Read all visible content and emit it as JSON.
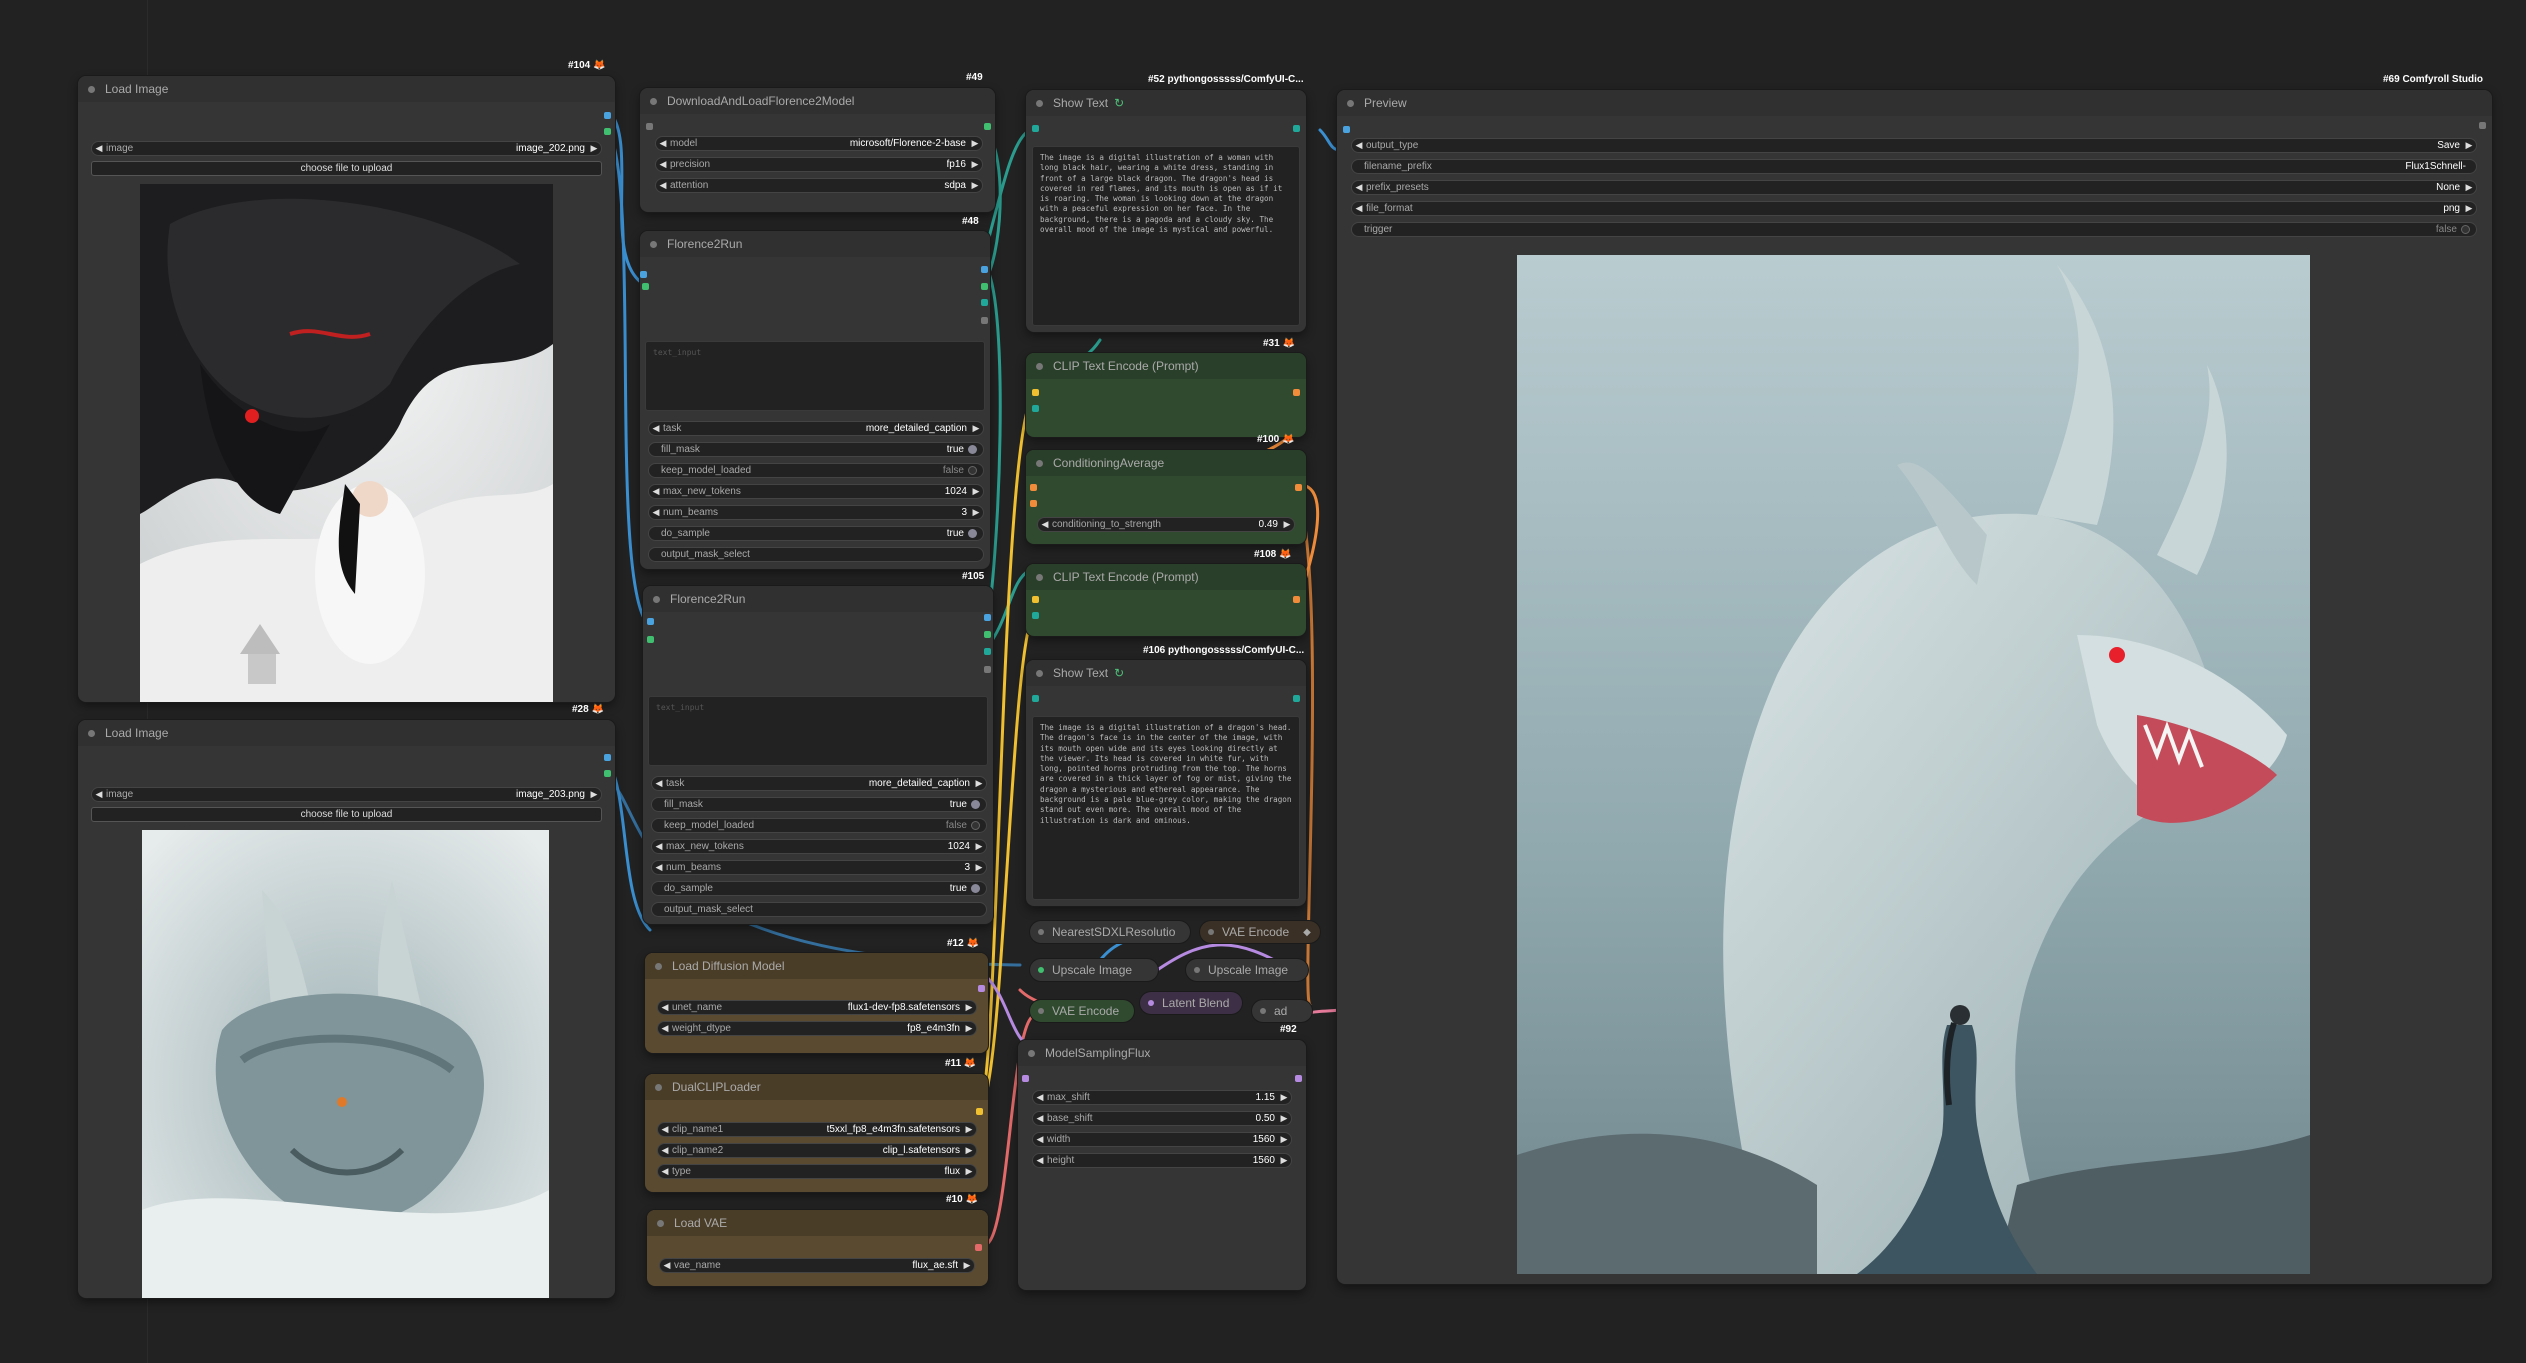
{
  "colors": {
    "canvas": "#222222",
    "node": "#353535",
    "green_node": "#2f4a2f",
    "brown_node": "#5a4a30"
  },
  "nodes": {
    "load_image_1": {
      "title": "Load Image",
      "badge": "#104",
      "image_label": "image",
      "image_value": "image_202.png",
      "upload_label": "choose file to upload"
    },
    "load_image_2": {
      "title": "Load Image",
      "badge": "#28",
      "image_label": "image",
      "image_value": "image_203.png",
      "upload_label": "choose file to upload"
    },
    "download_florence": {
      "title": "DownloadAndLoadFlorence2Model",
      "badge": "#49",
      "widgets": [
        {
          "label": "model",
          "value": "microsoft/Florence-2-base"
        },
        {
          "label": "precision",
          "value": "fp16"
        },
        {
          "label": "attention",
          "value": "sdpa"
        }
      ]
    },
    "florence_run_1": {
      "title": "Florence2Run",
      "badge": "#48",
      "placeholder": "text_input",
      "widgets": [
        {
          "label": "task",
          "value": "more_detailed_caption"
        },
        {
          "label": "fill_mask",
          "value": "true"
        },
        {
          "label": "keep_model_loaded",
          "value": "false"
        },
        {
          "label": "max_new_tokens",
          "value": "1024"
        },
        {
          "label": "num_beams",
          "value": "3"
        },
        {
          "label": "do_sample",
          "value": "true"
        },
        {
          "label": "output_mask_select",
          "value": ""
        }
      ]
    },
    "florence_run_2": {
      "title": "Florence2Run",
      "badge": "#105",
      "placeholder": "text_input",
      "widgets": [
        {
          "label": "task",
          "value": "more_detailed_caption"
        },
        {
          "label": "fill_mask",
          "value": "true"
        },
        {
          "label": "keep_model_loaded",
          "value": "false"
        },
        {
          "label": "max_new_tokens",
          "value": "1024"
        },
        {
          "label": "num_beams",
          "value": "3"
        },
        {
          "label": "do_sample",
          "value": "true"
        },
        {
          "label": "output_mask_select",
          "value": ""
        }
      ]
    },
    "load_diffusion": {
      "title": "Load Diffusion Model",
      "badge": "#12",
      "widgets": [
        {
          "label": "unet_name",
          "value": "flux1-dev-fp8.safetensors"
        },
        {
          "label": "weight_dtype",
          "value": "fp8_e4m3fn"
        }
      ]
    },
    "dual_clip": {
      "title": "DualCLIPLoader",
      "badge": "#11",
      "widgets": [
        {
          "label": "clip_name1",
          "value": "t5xxl_fp8_e4m3fn.safetensors"
        },
        {
          "label": "clip_name2",
          "value": "clip_l.safetensors"
        },
        {
          "label": "type",
          "value": "flux"
        }
      ]
    },
    "load_vae": {
      "title": "Load VAE",
      "badge": "#10",
      "widgets": [
        {
          "label": "vae_name",
          "value": "flux_ae.sft"
        }
      ]
    },
    "show_text_1": {
      "title": "Show Text",
      "badge": "#52 pythongosssss/ComfyUI-C...",
      "text": "The image is a digital illustration of a woman with long black hair, wearing a white dress, standing in front of a large black dragon. The dragon's head is covered in red flames, and its mouth is open as if it is roaring. The woman is looking down at the dragon with a peaceful expression on her face. In the background, there is a pagoda and a cloudy sky. The overall mood of the image is mystical and powerful."
    },
    "clip_encode_1": {
      "title": "CLIP Text Encode (Prompt)",
      "badge": "#31"
    },
    "cond_avg": {
      "title": "ConditioningAverage",
      "badge": "#100",
      "widget": {
        "label": "conditioning_to_strength",
        "value": "0.49"
      }
    },
    "clip_encode_2": {
      "title": "CLIP Text Encode (Prompt)",
      "badge": "#108"
    },
    "show_text_2": {
      "title": "Show Text",
      "badge": "#106 pythongosssss/ComfyUI-C...",
      "text": "The image is a digital illustration of a dragon's head. The dragon's face is in the center of the image, with its mouth open wide and its eyes looking directly at the viewer. Its head is covered in white fur, with long, pointed horns protruding from the top. The horns are covered in a thick layer of fog or mist, giving the dragon a mysterious and ethereal appearance. The background is a pale blue-grey color, making the dragon stand out even more. The overall mood of the illustration is dark and ominous."
    },
    "nearest_sdxl": {
      "title": "NearestSDXLResolutio"
    },
    "vae_encode_1": {
      "title": "VAE Encode"
    },
    "upscale_1": {
      "title": "Upscale Image"
    },
    "upscale_2": {
      "title": "Upscale Image"
    },
    "vae_encode_2": {
      "title": "VAE Encode"
    },
    "latent_blend": {
      "title": "Latent Blend"
    },
    "ad": {
      "title": "ad"
    },
    "model_sampling": {
      "title": "ModelSamplingFlux",
      "badge": "#92",
      "widgets": [
        {
          "label": "max_shift",
          "value": "1.15"
        },
        {
          "label": "base_shift",
          "value": "0.50"
        },
        {
          "label": "width",
          "value": "1560"
        },
        {
          "label": "height",
          "value": "1560"
        }
      ]
    },
    "preview": {
      "title": "Preview",
      "badge": "#69 Comfyroll Studio",
      "widgets": [
        {
          "label": "output_type",
          "value": "Save"
        },
        {
          "label": "filename_prefix",
          "value": "Flux1Schnell-"
        },
        {
          "label": "prefix_presets",
          "value": "None"
        },
        {
          "label": "file_format",
          "value": "png"
        },
        {
          "label": "trigger",
          "value": "false"
        }
      ]
    }
  }
}
